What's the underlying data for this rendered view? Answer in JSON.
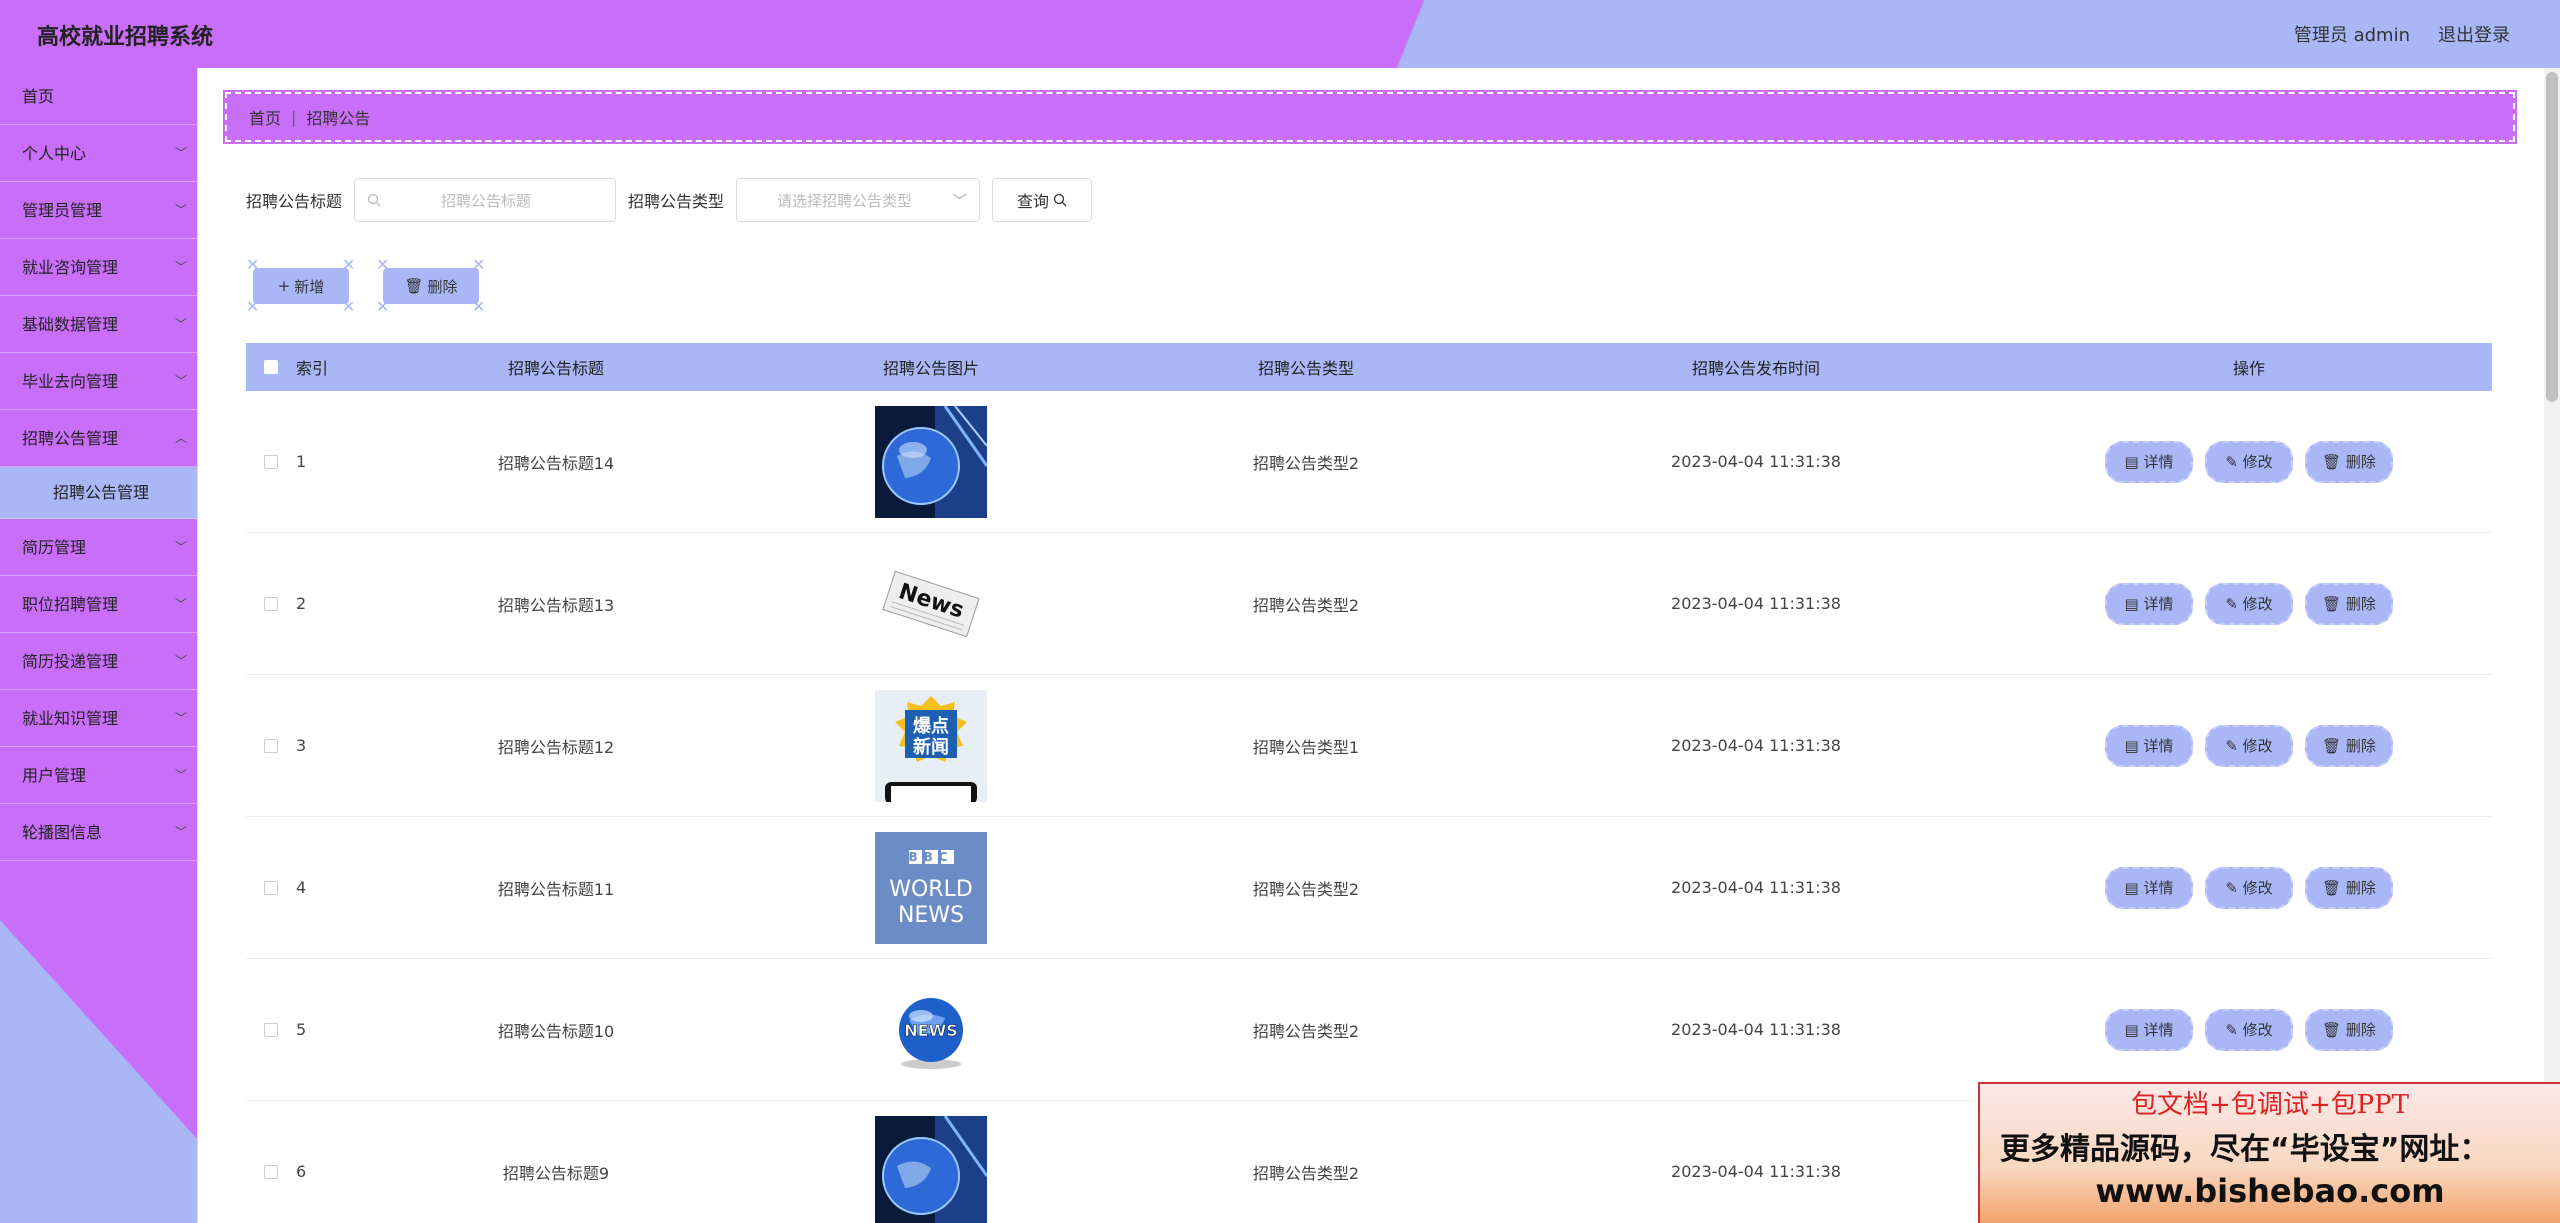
{
  "header": {
    "title": "高校就业招聘系统",
    "user": "管理员 admin",
    "logout": "退出登录"
  },
  "sidebar": {
    "items": [
      {
        "label": "首页"
      },
      {
        "label": "个人中心"
      },
      {
        "label": "管理员管理"
      },
      {
        "label": "就业咨询管理"
      },
      {
        "label": "基础数据管理"
      },
      {
        "label": "毕业去向管理"
      },
      {
        "label": "招聘公告管理"
      },
      {
        "label": "简历管理"
      },
      {
        "label": "职位招聘管理"
      },
      {
        "label": "简历投递管理"
      },
      {
        "label": "就业知识管理"
      },
      {
        "label": "用户管理"
      },
      {
        "label": "轮播图信息"
      }
    ],
    "sub_active": "招聘公告管理"
  },
  "breadcrumb": {
    "home": "首页",
    "sep": "|",
    "current": "招聘公告"
  },
  "search": {
    "title_label": "招聘公告标题",
    "title_placeholder": "招聘公告标题",
    "type_label": "招聘公告类型",
    "type_placeholder": "请选择招聘公告类型",
    "query_label": "查询"
  },
  "actions": {
    "add": "新增",
    "delete": "删除"
  },
  "table": {
    "headers": [
      "索引",
      "招聘公告标题",
      "招聘公告图片",
      "招聘公告类型",
      "招聘公告发布时间",
      "操作"
    ],
    "rows": [
      {
        "idx": "1",
        "title": "招聘公告标题14",
        "img": "globe-news",
        "type": "招聘公告类型2",
        "time": "2023-04-04 11:31:38"
      },
      {
        "idx": "2",
        "title": "招聘公告标题13",
        "img": "news-paper",
        "type": "招聘公告类型2",
        "time": "2023-04-04 11:31:38"
      },
      {
        "idx": "3",
        "title": "招聘公告标题12",
        "img": "bao-dian-xin-wen",
        "type": "招聘公告类型1",
        "time": "2023-04-04 11:31:38"
      },
      {
        "idx": "4",
        "title": "招聘公告标题11",
        "img": "bbc-world-news",
        "type": "招聘公告类型2",
        "time": "2023-04-04 11:31:38"
      },
      {
        "idx": "5",
        "title": "招聘公告标题10",
        "img": "news-globe",
        "type": "招聘公告类型2",
        "time": "2023-04-04 11:31:38"
      },
      {
        "idx": "6",
        "title": "招聘公告标题9",
        "img": "globe-news",
        "type": "招聘公告类型2",
        "time": "2023-04-04 11:31:38"
      }
    ],
    "ops": {
      "detail": "详情",
      "edit": "修改",
      "delete": "删除"
    }
  },
  "image_text": {
    "news": "News",
    "baodian1": "爆点",
    "baodian2": "新闻",
    "bbc": "BBC",
    "world": "WORLD",
    "news_caps": "NEWS",
    "news_small": "NEWS"
  },
  "promo": {
    "line1": "包文档+包调试+包PPT",
    "line2": "更多精品源码，尽在“毕设宝”网址：",
    "line3": "www.bishebao.com"
  },
  "colors": {
    "purple": "#c86ef8",
    "lavender": "#aab7f7"
  }
}
